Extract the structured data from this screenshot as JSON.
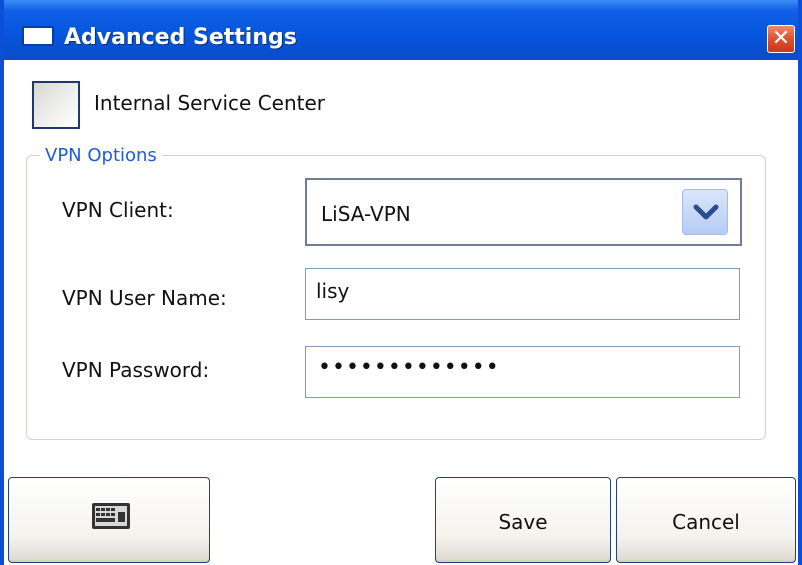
{
  "window": {
    "title": "Advanced Settings",
    "close_glyph": "✕"
  },
  "service_center": {
    "label": "Internal Service Center",
    "checked": false
  },
  "vpn_options": {
    "legend": "VPN Options",
    "client": {
      "label": "VPN Client:",
      "value": "LiSA-VPN"
    },
    "user_name": {
      "label": "VPN User Name:",
      "value": "lisy"
    },
    "password": {
      "label": "VPN Password:",
      "masked_value": "•••••••••••••"
    }
  },
  "buttons": {
    "keyboard_icon": "keyboard-icon",
    "save": "Save",
    "cancel": "Cancel"
  },
  "colors": {
    "titlebar": "#0654dd",
    "legend": "#1e5cd8",
    "close": "#e0502a"
  }
}
